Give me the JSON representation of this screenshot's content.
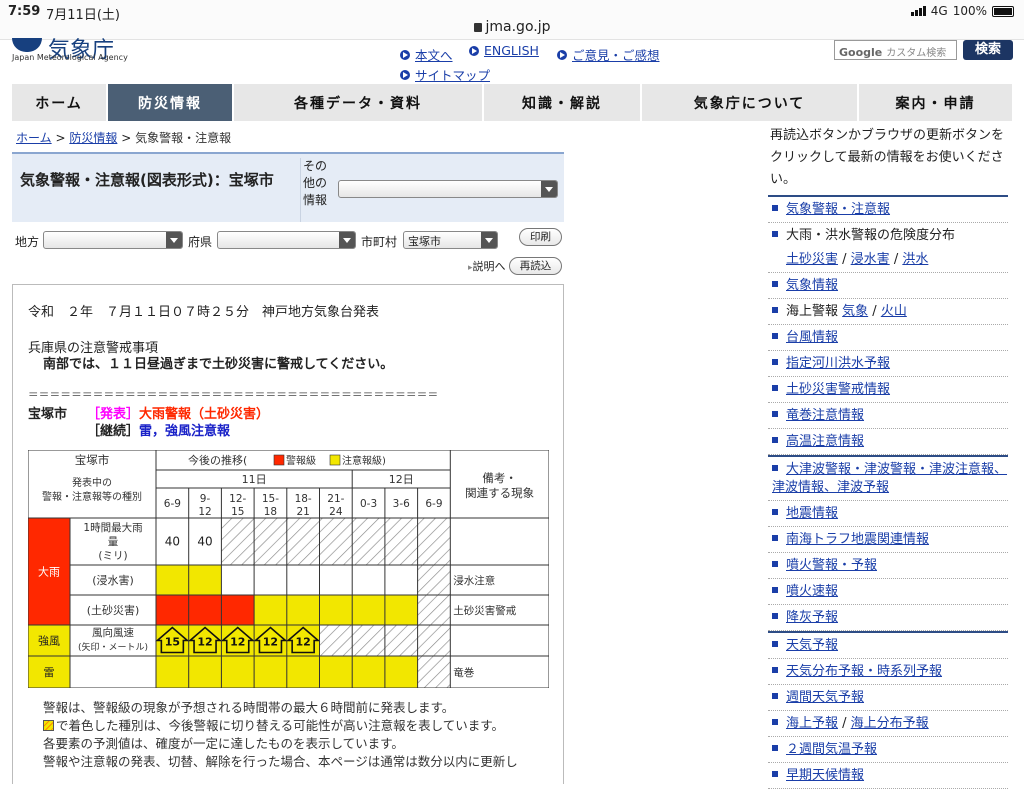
{
  "status_bar": {
    "time": "7:59",
    "date": "7月11日(土)",
    "url": "jma.go.jp",
    "network": "4G",
    "battery": "100%"
  },
  "header": {
    "logo_text": "気象庁",
    "logo_en": "Japan Meteorological Agency",
    "links": [
      "本文へ",
      "ENGLISH",
      "ご意見・ご感想",
      "サイトマップ"
    ],
    "search_brand": "Google",
    "search_placeholder": "カスタム検索",
    "search_button": "検索"
  },
  "nav": {
    "tabs": [
      "ホーム",
      "防災情報",
      "各種データ・資料",
      "知識・解説",
      "気象庁について",
      "案内・申請"
    ],
    "active": "防災情報"
  },
  "breadcrumb": {
    "items": [
      "ホーム",
      "防災情報"
    ],
    "current": "気象警報・注意報",
    "sep": ">"
  },
  "title_box": {
    "title": "気象警報・注意報(図表形式)：宝塚市",
    "other_label": "その他の情報"
  },
  "filters": {
    "region_label": "地方",
    "pref_label": "府県",
    "city_label": "市町村",
    "city_value": "宝塚市",
    "print_button": "印刷",
    "explain_link": "説明へ",
    "reload_button": "再読込"
  },
  "bulletin": {
    "issued": "令和　２年　７月１１日０７時２５分　神戸地方気象台発表",
    "notice_heading": "兵庫県の注意警戒事項",
    "notice_body": "南部では、１１日昼過ぎまで土砂災害に警戒してください。",
    "separator": "＝＝＝＝＝＝＝＝＝＝＝＝＝＝＝＝＝＝＝＝＝＝＝＝＝＝＝＝＝＝＝＝＝＝＝＝＝＝",
    "city": "宝塚市",
    "status1_tag": "［発表］",
    "status1_text": "大雨警報（土砂災害）",
    "status2_tag": "［継続］",
    "status2_text": "雷，強風注意報"
  },
  "table": {
    "corner_city": "宝塚市",
    "corner_sub": "発表中の警報・注意報等の種別",
    "trend_header": "今後の推移(",
    "legend_warning": "警報級",
    "legend_advisory": "注意報級)",
    "day1": "11日",
    "day2": "12日",
    "remarks_header": "備考・関連する現象",
    "time_slots": [
      "6-9",
      "9-12",
      "12-15",
      "15-18",
      "18-21",
      "21-24",
      "0-3",
      "3-6",
      "6-9"
    ],
    "groups": [
      {
        "name": "大雨",
        "rows": 3,
        "color": "red"
      },
      {
        "name": "強風",
        "rows": 1,
        "color": "yellow"
      },
      {
        "name": "雷",
        "rows": 1,
        "color": "yellow"
      }
    ],
    "rows": [
      {
        "label": "1時間最大雨量(ミリ)",
        "cells": [
          "40",
          "40",
          "h",
          "h",
          "h",
          "h",
          "h",
          "h",
          "h"
        ],
        "remark": ""
      },
      {
        "label": "(浸水害)",
        "cells": [
          "y",
          "y",
          "w",
          "w",
          "w",
          "w",
          "w",
          "w",
          "h"
        ],
        "remark": "浸水注意"
      },
      {
        "label": "(土砂災害)",
        "cells": [
          "r",
          "r",
          "r",
          "y",
          "y",
          "y",
          "y",
          "y",
          "h"
        ],
        "remark": "土砂災害警戒"
      },
      {
        "label": "風向風速",
        "sublabel": "(矢印・メートル)",
        "cells": [
          "y",
          "y",
          "y",
          "y",
          "y",
          "h",
          "h",
          "h",
          "h"
        ],
        "arrows": [
          "15",
          "12",
          "12",
          "12",
          "12"
        ],
        "remark": ""
      },
      {
        "label": "",
        "cells": [
          "y",
          "y",
          "y",
          "y",
          "y",
          "y",
          "y",
          "y",
          "h"
        ],
        "remark": "竜巻"
      }
    ]
  },
  "notes": [
    "警報は、警報級の現象が予想される時間帯の最大６時間前に発表します。",
    "で着色した種別は、今後警報に切り替える可能性が高い注意報を表しています。",
    "各要素の予測値は、確度が一定に達したものを表示しています。",
    "警報や注意報の発表、切替、解除を行った場合、本ページは通常は数分以内に更新し"
  ],
  "sidebar": {
    "note": "再読込ボタンかブラウザの更新ボタンをクリックして最新の情報をお使いください。",
    "groups": [
      [
        {
          "type": "link",
          "text": "気象警報・注意報"
        },
        {
          "type": "multi",
          "text": "大雨・洪水警報の危険度分布",
          "links": [
            "土砂災害",
            "浸水害",
            "洪水"
          ]
        },
        {
          "type": "link",
          "text": "気象情報"
        },
        {
          "type": "mixed",
          "text": "海上警報",
          "links": [
            "気象",
            "火山"
          ]
        },
        {
          "type": "link",
          "text": "台風情報"
        },
        {
          "type": "link",
          "text": "指定河川洪水予報"
        },
        {
          "type": "link",
          "text": "土砂災害警戒情報"
        },
        {
          "type": "link",
          "text": "竜巻注意情報"
        },
        {
          "type": "link",
          "text": "高温注意情報"
        }
      ],
      [
        {
          "type": "link",
          "text": "大津波警報・津波警報・津波注意報、津波情報、津波予報"
        },
        {
          "type": "link",
          "text": "地震情報"
        },
        {
          "type": "link",
          "text": "南海トラフ地震関連情報"
        },
        {
          "type": "link",
          "text": "噴火警報・予報"
        },
        {
          "type": "link",
          "text": "噴火速報"
        },
        {
          "type": "link",
          "text": "降灰予報"
        }
      ],
      [
        {
          "type": "link",
          "text": "天気予報"
        },
        {
          "type": "link",
          "text": "天気分布予報・時系列予報"
        },
        {
          "type": "link",
          "text": "週間天気予報"
        },
        {
          "type": "pair",
          "links": [
            "海上予報",
            "海上分布予報"
          ]
        },
        {
          "type": "link",
          "text": "２週間気温予報"
        },
        {
          "type": "link",
          "text": "早期天候情報"
        }
      ]
    ]
  },
  "colors": {
    "warning": "#ff2800",
    "advisory": "#f2e700",
    "nav_active": "#4b5f75",
    "link": "#1a3ea8",
    "status_tag": "#ff00ff",
    "warning_text": "#ff2800",
    "advisory_text": "#1a22c8"
  }
}
